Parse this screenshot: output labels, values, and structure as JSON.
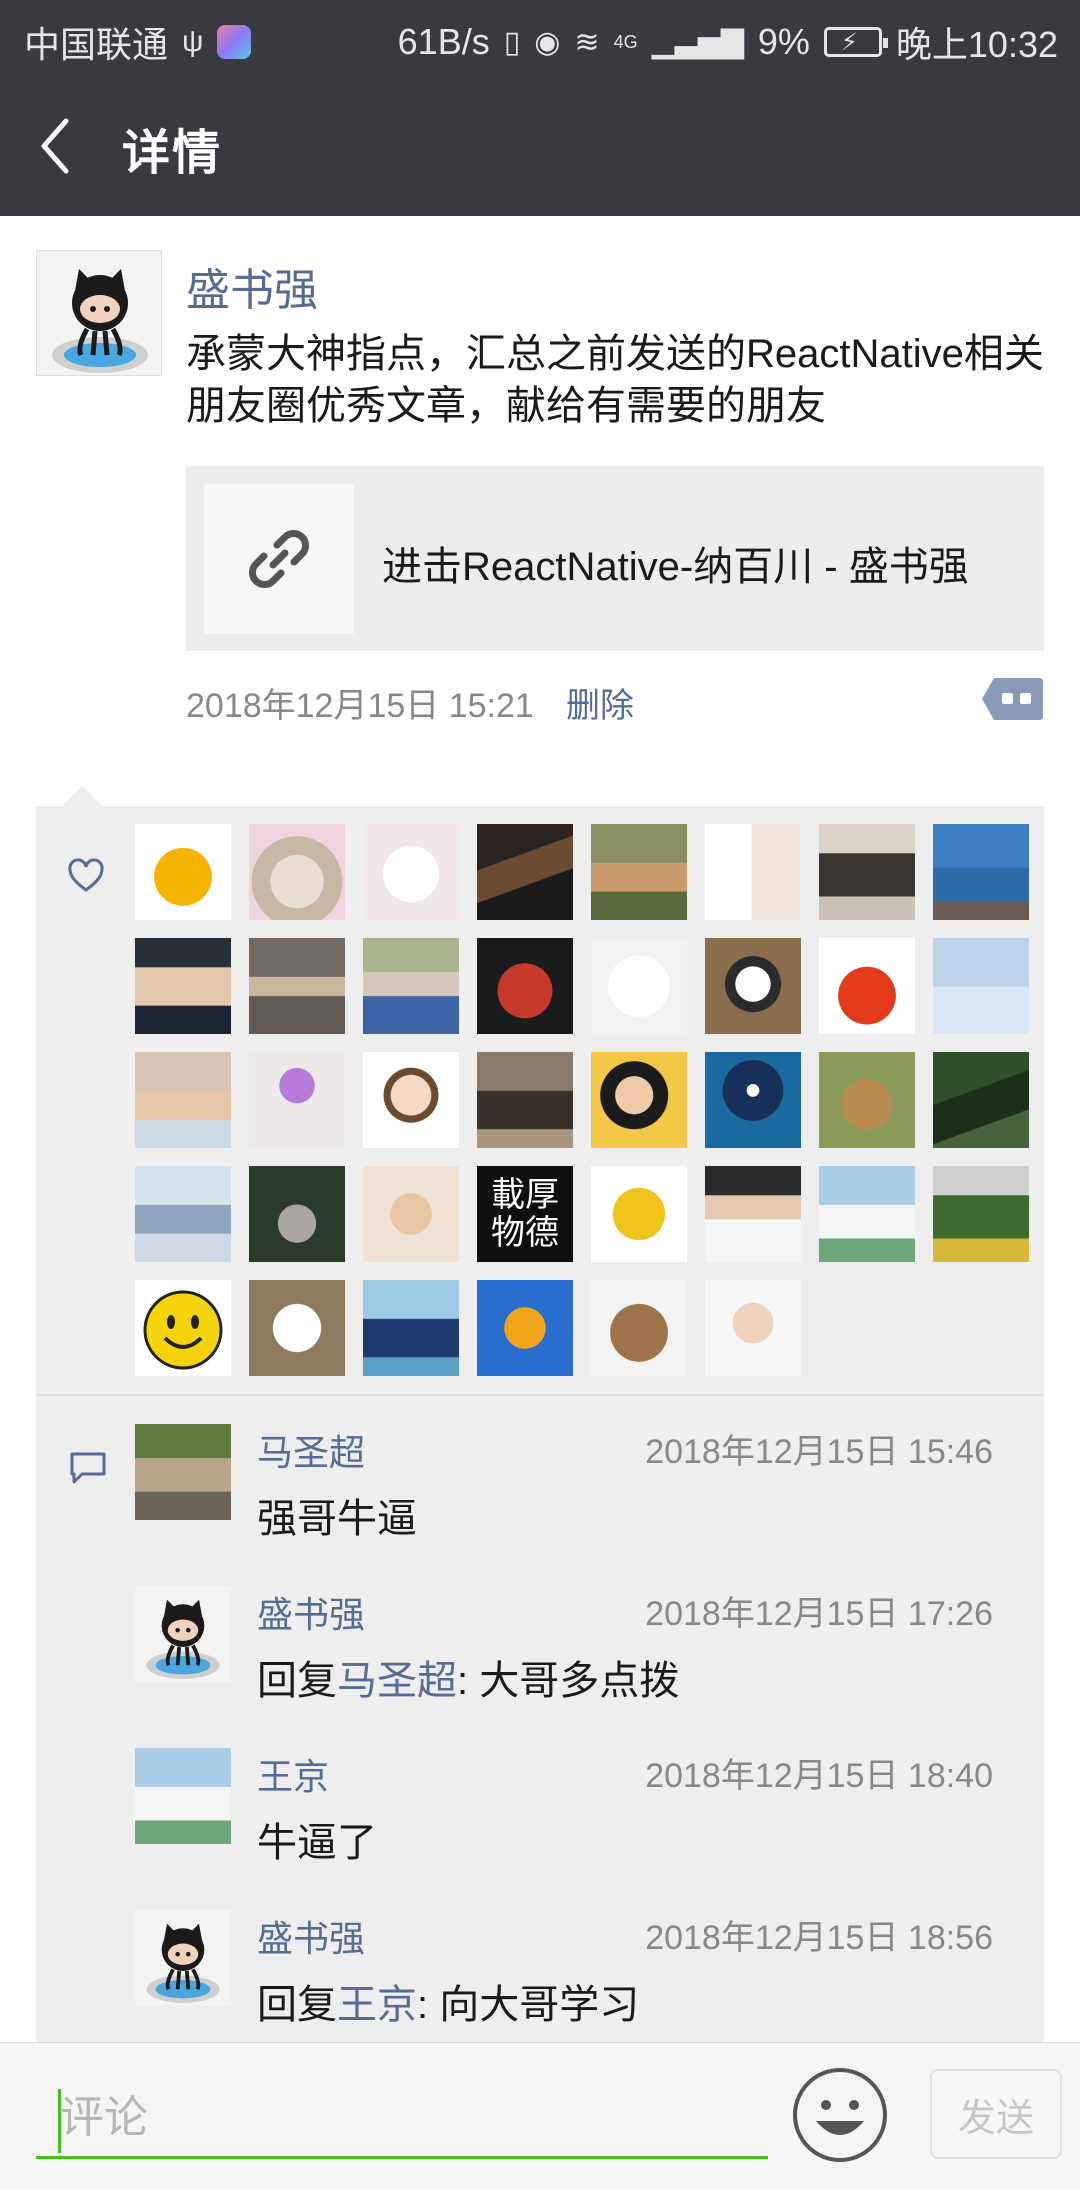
{
  "status_bar": {
    "carrier": "中国联通",
    "net_speed": "61B/s",
    "network_type": "4G",
    "battery": "9%",
    "time": "晚上10:32"
  },
  "nav": {
    "title": "详情"
  },
  "post": {
    "author": "盛书强",
    "text": "承蒙大神指点，汇总之前发送的ReactNative相关朋友圈优秀文章，献给有需要的朋友",
    "link_title": "进击ReactNative-纳百川 - 盛书强",
    "time": "2018年12月15日 15:21",
    "delete_label": "删除"
  },
  "likes": {
    "avatars": [
      "orange-gourd",
      "cat-with-flowers",
      "white-dog-cartoon",
      "puppy-photo",
      "child-on-street",
      "couple-cartoon",
      "family-photo",
      "sea-landscape",
      "man-with-earphones",
      "sunset-sky",
      "girl-in-dress",
      "child-red-circle",
      "hat-cartoon",
      "kung-fu-panda",
      "red-apple",
      "salt-flat",
      "girl-on-beach",
      "purple-umbrella",
      "boy-with-glasses",
      "man-in-alley",
      "girl-portrait",
      "eclipse-night",
      "tabby-cat",
      "palm-leaves",
      "cloudy-sky",
      "buddha-statue",
      "cartoon-kids-kiss",
      "calligraphy",
      "wall-e-robot",
      "man-white-shirt",
      "wedding-photo",
      "loki-lego",
      "smiley-face",
      "bird-cartoon",
      "man-on-beach",
      "sunflower",
      "teddy-bear",
      "bald-man"
    ],
    "calligraphy_text": "載厚物德"
  },
  "comments": [
    {
      "name": "马圣超",
      "time": "2018年12月15日 15:46",
      "text": "强哥牛逼",
      "reply_prefix": "",
      "reply_to": "",
      "reply_suffix": "",
      "avatar": "walking-child"
    },
    {
      "name": "盛书强",
      "time": "2018年12月15日 17:26",
      "text": "",
      "reply_prefix": "回复",
      "reply_to": "马圣超",
      "reply_suffix": ": 大哥多点拨",
      "avatar": "github-octocat"
    },
    {
      "name": "王京",
      "time": "2018年12月15日 18:40",
      "text": "牛逼了",
      "reply_prefix": "",
      "reply_to": "",
      "reply_suffix": "",
      "avatar": "wedding-photo"
    },
    {
      "name": "盛书强",
      "time": "2018年12月15日 18:56",
      "text": "",
      "reply_prefix": "回复",
      "reply_to": "王京",
      "reply_suffix": ": 向大哥学习",
      "avatar": "github-octocat"
    }
  ],
  "input_bar": {
    "placeholder": "评论",
    "send_label": "发送"
  },
  "colors": {
    "bar_bg": "#393a3f",
    "link_blue": "#576b95",
    "accent_green": "#45c01a",
    "feedback_bg": "#eeeeee"
  }
}
